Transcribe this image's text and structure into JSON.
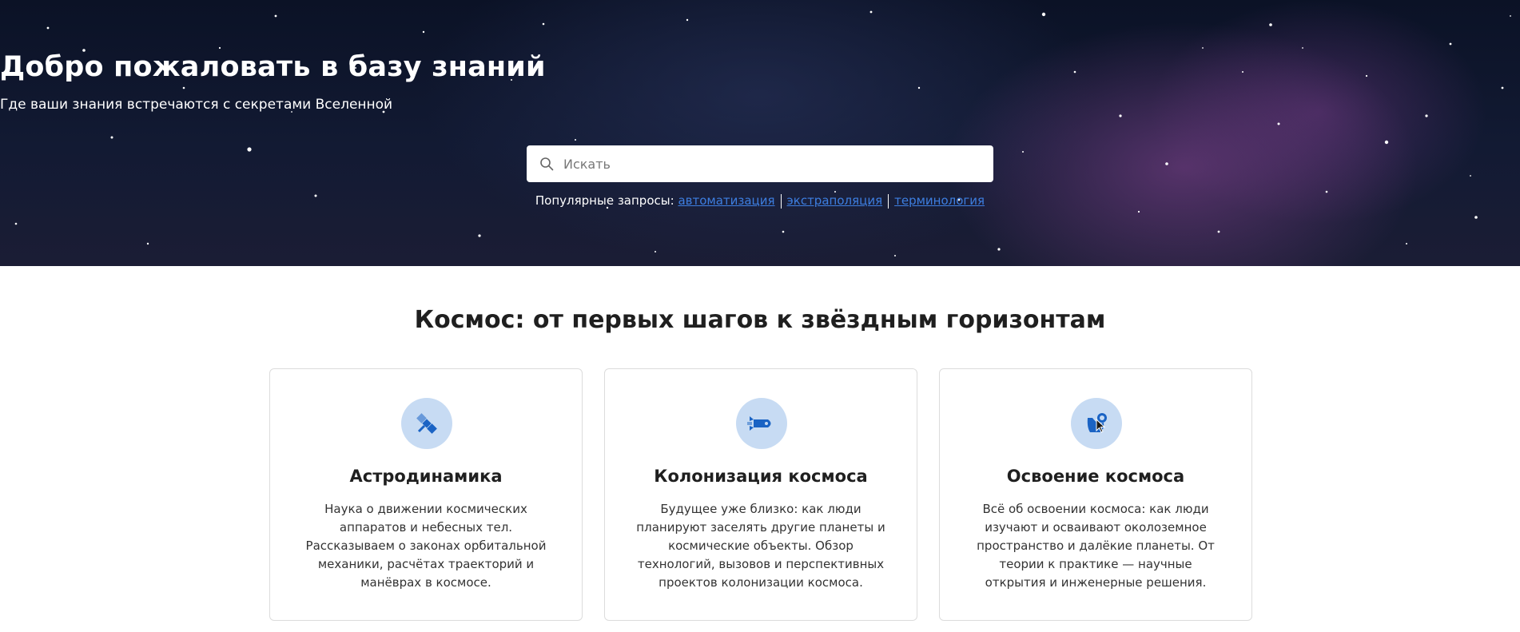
{
  "hero": {
    "title": "Добро пожаловать в базу знаний",
    "subtitle": "Где ваши знания встречаются с секретами Вселенной",
    "search": {
      "placeholder": "Искать",
      "value": ""
    },
    "popular": {
      "label": "Популярные запросы:",
      "links": [
        "автоматизация",
        "экстраполяция",
        "терминология"
      ]
    }
  },
  "section": {
    "title": "Космос: от первых шагов к звёздным горизонтам"
  },
  "cards": [
    {
      "icon": "satellite-icon",
      "title": "Астродинамика",
      "text": "Наука о движении космических аппаратов и небесных тел. Рассказываем о законах орбитальной механики, расчётах траекторий и манёврах в космосе."
    },
    {
      "icon": "rocket-icon",
      "title": "Колонизация космоса",
      "text": "Будущее уже близко: как люди планируют заселять другие планеты и космические объекты. Обзор технологий, вызовов и перспективных проектов колонизации космоса."
    },
    {
      "icon": "astronaut-icon",
      "title": "Освоение космоса",
      "text": "Всё об освоении космоса: как люди изучают и осваивают околоземное пространство и далёкие планеты. От теории к практике — научные открытия и инженерные решения."
    }
  ],
  "colors": {
    "accent": "#1a63c4",
    "icon_bg": "#c7dbf3",
    "link": "#3d7ee0"
  }
}
